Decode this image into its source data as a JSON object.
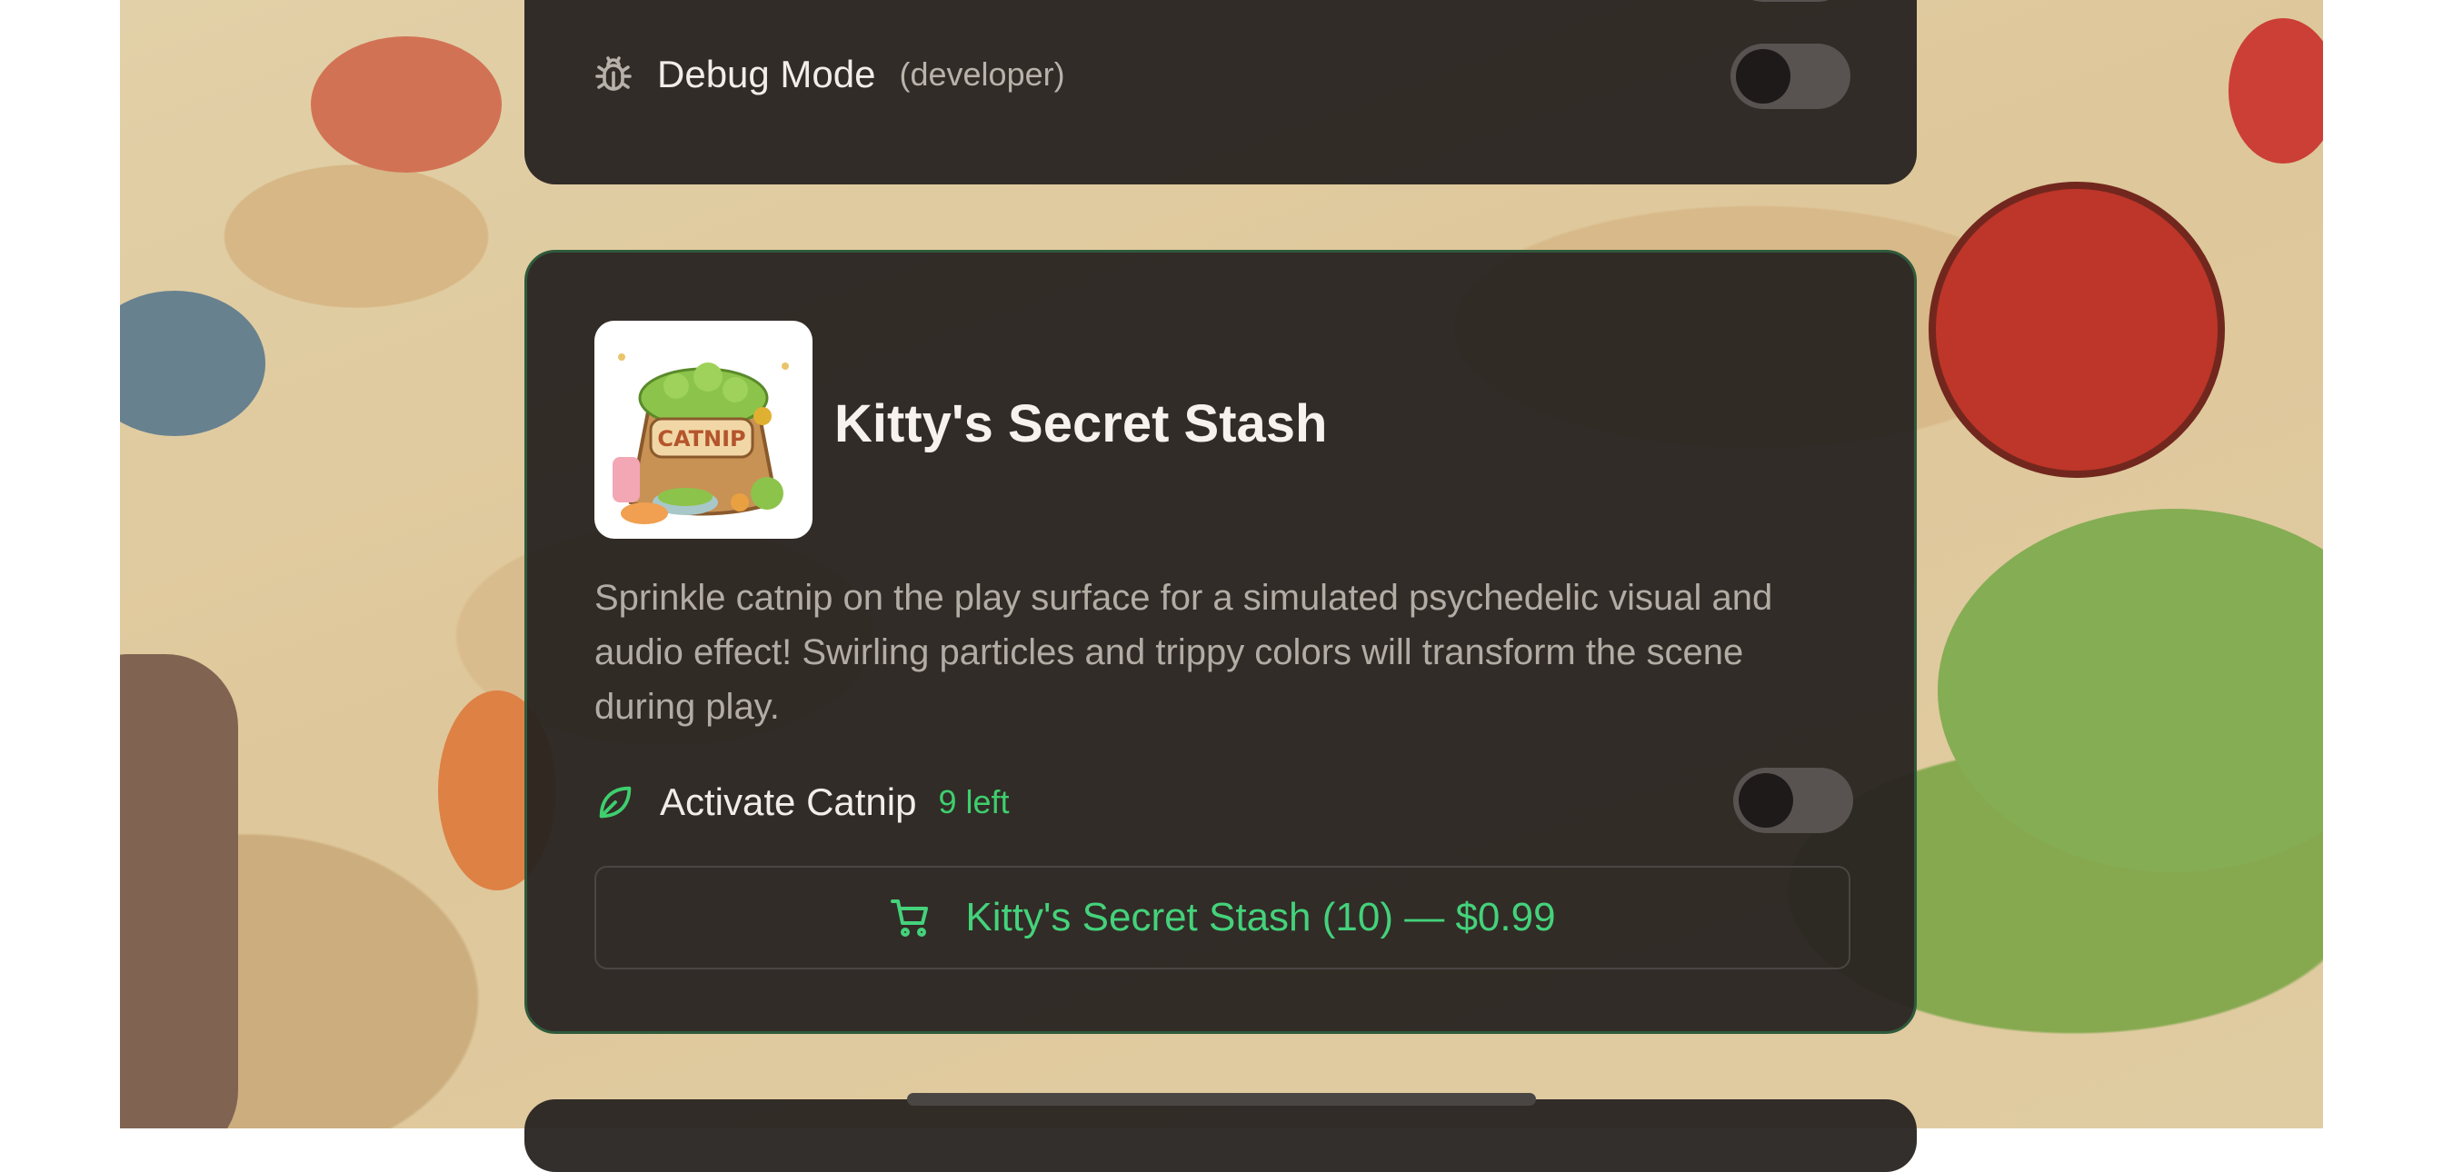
{
  "settings": {
    "debug_label": "Debug Mode",
    "debug_hint": "(developer)",
    "debug_enabled": false
  },
  "product": {
    "title": "Kitty's Secret Stash",
    "image_label": "CATNIP",
    "description": "Sprinkle catnip on the play surface for a simulated psychedelic visual and audio effect! Swirling particles and trippy colors will transform the scene during play.",
    "activate_label": "Activate Catnip",
    "remaining": "9 left",
    "activate_enabled": false,
    "buy_label": "Kitty's Secret Stash (10) — $0.99"
  },
  "icons": {
    "debug": "bug-icon",
    "activate": "leaf-icon",
    "buy": "cart-icon"
  },
  "colors": {
    "accent": "#3ecf6e",
    "card_bg": "#262220",
    "card_border": "#2f5a3c"
  }
}
